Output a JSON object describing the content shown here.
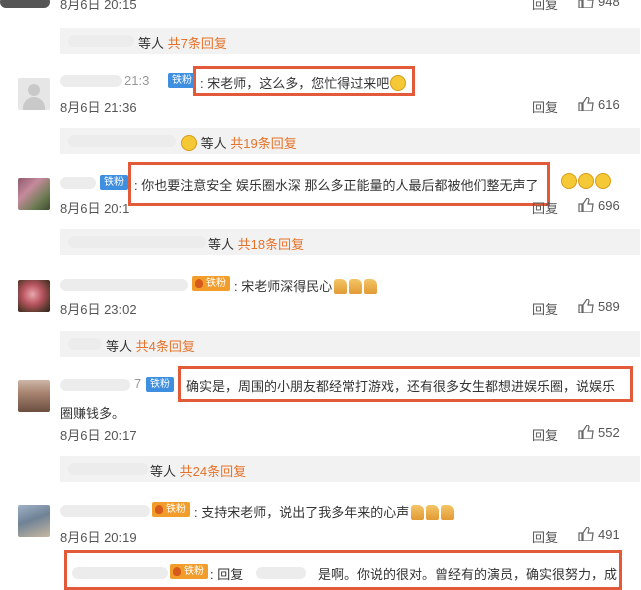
{
  "top": {
    "timestamp": "8月6日 20:15",
    "reply_label": "回复",
    "like_count": "948"
  },
  "threads": [
    {
      "subreply_prefix": "等人",
      "subreply_count": "共7条回复"
    },
    {
      "user_suffix": "21:3",
      "badge": "铁粉",
      "text": ": 宋老师，这么多，您忙得过来吧",
      "timestamp": "8月6日 21:36",
      "reply_label": "回复",
      "like_count": "616",
      "subreply_prefix": "等人",
      "subreply_count": "共19条回复"
    },
    {
      "badge": "铁粉",
      "text": ": 你也要注意安全  娱乐圈水深  那么多正能量的人最后都被他们整无声了",
      "timestamp": "8月6日 20:1",
      "reply_label": "回复",
      "like_count": "696",
      "subreply_prefix": "等人",
      "subreply_count": "共18条回复"
    },
    {
      "badge": "铁粉",
      "text": ": 宋老师深得民心",
      "timestamp": "8月6日 23:02",
      "reply_label": "回复",
      "like_count": "589",
      "subreply_prefix": "等人",
      "subreply_count": "共4条回复"
    },
    {
      "user_suffix": "7",
      "badge": "铁粉",
      "text_line1": "确实是，周围的小朋友都经常打游戏，还有很多女生都想进娱乐圈，说娱乐",
      "text_line2": "圈赚钱多。",
      "timestamp": "8月6日 20:17",
      "reply_label": "回复",
      "like_count": "552",
      "subreply_prefix": "等人",
      "subreply_count": "共24条回复"
    },
    {
      "badge": "铁粉",
      "text": ": 支持宋老师，说出了我多年来的心声",
      "timestamp": "8月6日 20:19",
      "reply_label": "回复",
      "like_count": "491"
    },
    {
      "badge": "铁粉",
      "text_reply": ": 回复",
      "text": "是啊。你说的很对。曾经有的演员，确实很努力，成"
    }
  ],
  "colors": {
    "highlight": "#e25a3a",
    "subreply_count": "#e6732a",
    "badge_blue": "#3f8fe0",
    "badge_orange": "#f29d2b"
  },
  "icons": [
    "thumbs-up-icon",
    "laughing-emoji-icon",
    "clap-emoji-icon",
    "default-avatar-icon"
  ]
}
